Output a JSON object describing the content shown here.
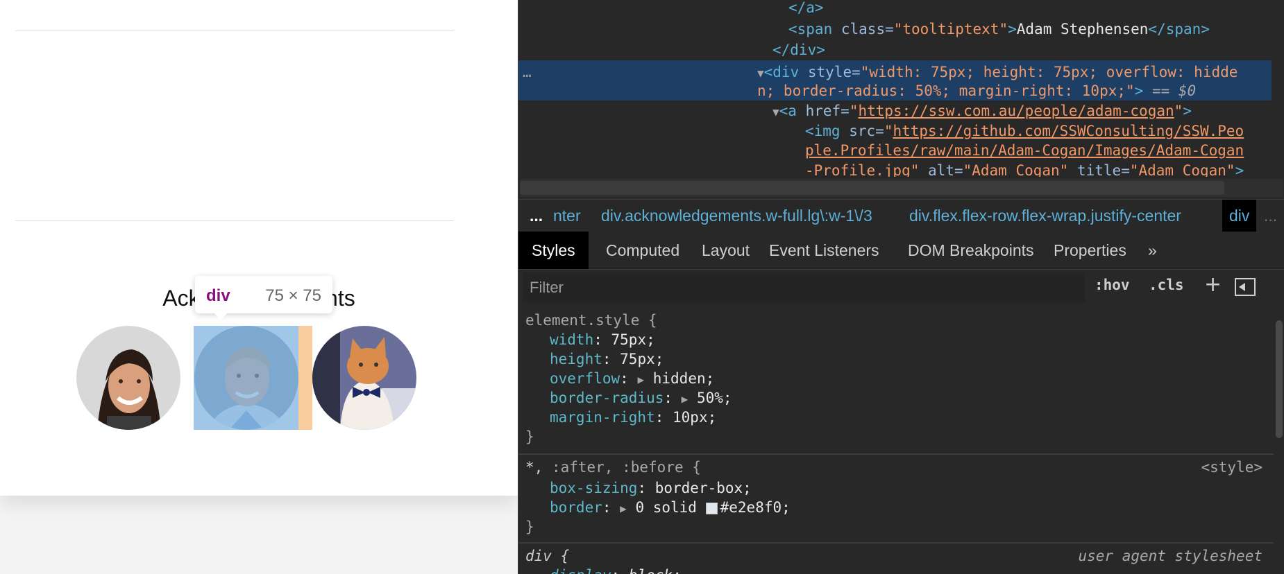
{
  "page": {
    "acknowledgements_title": "Acknowledgements",
    "people": [
      {
        "alt": "Adam Stephensen"
      },
      {
        "alt": "Adam Cogan"
      },
      {
        "alt": "cat"
      }
    ],
    "tooltip": {
      "tag": "div",
      "dimensions": "75 × 75"
    }
  },
  "devtools": {
    "dom": {
      "close_a": "</a>",
      "span_open": "<span",
      "span_class_attr": "class=",
      "span_class_val": "\"tooltiptext\"",
      "span_gt": ">",
      "span_text": "Adam Stephensen",
      "span_close": "</span>",
      "div_close": "</div>",
      "sel_div_open": "<div",
      "sel_style_attr": "style=",
      "sel_style_val_1": "\"width: 75px; height: 75px; overflow: hidde",
      "sel_style_val_2": "n; border-radius: 50%; margin-right: 10px;\"",
      "sel_gt": ">",
      "sel_eq": "== $0",
      "ellipsis": "…",
      "a_open": "<a",
      "a_href_attr": "href=",
      "a_href_q1": "\"",
      "a_href_val": "https://ssw.com.au/people/adam-cogan",
      "a_href_q2": "\"",
      "a_gt": ">",
      "img_open": "<img",
      "img_src_attr": "src=",
      "img_src_q": "\"",
      "img_src_1": "https://github.com/SSWConsulting/SSW.Peo",
      "img_src_2": "ple.Profiles/raw/main/Adam-Cogan/Images/Adam-Cogan",
      "img_src_3": "-Profile.jpg",
      "img_src_q_end": "\"",
      "img_alt_attr": "alt=",
      "img_alt_val": "\"Adam Cogan\"",
      "img_title_attr": "title=",
      "img_title_val": "\"Adam Cogan\"",
      "img_gt": ">"
    },
    "breadcrumbs": {
      "more": "...",
      "c1": "nter",
      "c2": "div.acknowledgements.w-full.lg\\:w-1\\/3",
      "c3": "div.flex.flex-row.flex-wrap.justify-center",
      "c4": "div",
      "overflow": "..."
    },
    "tabs": [
      "Styles",
      "Computed",
      "Layout",
      "Event Listeners",
      "DOM Breakpoints",
      "Properties",
      "»"
    ],
    "filter": {
      "placeholder": "Filter",
      "hov": ":hov",
      "cls": ".cls",
      "plus": "+"
    },
    "rules": {
      "element_style": {
        "selector": "element.style {",
        "props": [
          {
            "name": "width",
            "value": "75px;"
          },
          {
            "name": "height",
            "value": "75px;"
          },
          {
            "name": "overflow",
            "value": "hidden;"
          },
          {
            "name": "border-radius",
            "value": "50%;"
          },
          {
            "name": "margin-right",
            "value": "10px;"
          }
        ],
        "close": "}"
      },
      "universal": {
        "selector_star": "*,",
        "selector_rest": ":after, :before {",
        "source": "<style>",
        "props": [
          {
            "name": "box-sizing",
            "value": "border-box;"
          },
          {
            "name": "border",
            "value": "0 solid",
            "color": "#e2e8f0",
            "color_text": "#e2e8f0;"
          }
        ],
        "close": "}"
      },
      "div": {
        "selector": "div {",
        "source": "user agent stylesheet",
        "props": [
          {
            "name": "display",
            "value": "block;"
          }
        ]
      }
    }
  }
}
